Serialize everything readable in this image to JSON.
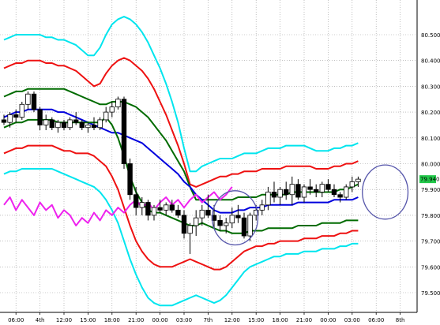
{
  "chart_data": {
    "type": "line",
    "title": "",
    "xlabel": "",
    "ylabel": "",
    "ylim": [
      79.4,
      80.6
    ],
    "grid": true,
    "grid_style": "dotted",
    "background": "#ffffff",
    "y_ticks": [
      "80.500",
      "80.400",
      "80.300",
      "80.200",
      "80.100",
      "80.000",
      "79.900",
      "79.800",
      "79.700",
      "79.600",
      "79.500"
    ],
    "x_ticks": [
      {
        "i": 2,
        "label": "06:00"
      },
      {
        "i": 6,
        "label": "4th"
      },
      {
        "i": 10,
        "label": "12:00"
      },
      {
        "i": 14,
        "label": "15:00"
      },
      {
        "i": 18,
        "label": "18:00"
      },
      {
        "i": 22,
        "label": "21:00"
      },
      {
        "i": 26,
        "label": "00:00"
      },
      {
        "i": 30,
        "label": "03:00"
      },
      {
        "i": 34,
        "label": "7th"
      },
      {
        "i": 38,
        "label": "12:00"
      },
      {
        "i": 42,
        "label": "15:00"
      },
      {
        "i": 46,
        "label": "18:00"
      },
      {
        "i": 50,
        "label": "21:00"
      },
      {
        "i": 54,
        "label": "00:00"
      },
      {
        "i": 58,
        "label": "03:00"
      },
      {
        "i": 62,
        "label": "06:00"
      },
      {
        "i": 66,
        "label": "8th"
      }
    ],
    "current_price": {
      "value": "79.940",
      "color": "#22c84a"
    },
    "candles": {
      "x_start": 0,
      "up_color": "#ffffff",
      "down_color": "#000000",
      "ohlc": [
        [
          80.17,
          80.19,
          80.15,
          80.16
        ],
        [
          80.16,
          80.2,
          80.14,
          80.19
        ],
        [
          80.19,
          80.21,
          80.16,
          80.18
        ],
        [
          80.18,
          80.24,
          80.17,
          80.23
        ],
        [
          80.23,
          80.28,
          80.21,
          80.27
        ],
        [
          80.27,
          80.28,
          80.2,
          80.21
        ],
        [
          80.21,
          80.22,
          80.13,
          80.15
        ],
        [
          80.15,
          80.19,
          80.13,
          80.17
        ],
        [
          80.17,
          80.18,
          80.13,
          80.14
        ],
        [
          80.14,
          80.17,
          80.12,
          80.16
        ],
        [
          80.16,
          80.17,
          80.13,
          80.14
        ],
        [
          80.14,
          80.18,
          80.13,
          80.17
        ],
        [
          80.17,
          80.2,
          80.15,
          80.16
        ],
        [
          80.16,
          80.17,
          80.13,
          80.14
        ],
        [
          80.14,
          80.16,
          80.12,
          80.15
        ],
        [
          80.15,
          80.18,
          80.13,
          80.14
        ],
        [
          80.14,
          80.18,
          80.13,
          80.17
        ],
        [
          80.17,
          80.22,
          80.16,
          80.2
        ],
        [
          80.2,
          80.24,
          80.18,
          80.22
        ],
        [
          80.22,
          80.26,
          80.21,
          80.25
        ],
        [
          80.25,
          80.26,
          79.98,
          80.0
        ],
        [
          80.0,
          80.02,
          79.86,
          79.88
        ],
        [
          79.88,
          79.91,
          79.8,
          79.83
        ],
        [
          79.83,
          79.87,
          79.8,
          79.85
        ],
        [
          79.85,
          79.86,
          79.78,
          79.8
        ],
        [
          79.8,
          79.84,
          79.78,
          79.83
        ],
        [
          79.83,
          79.86,
          79.81,
          79.82
        ],
        [
          79.82,
          79.85,
          79.8,
          79.84
        ],
        [
          79.84,
          79.86,
          79.81,
          79.82
        ],
        [
          79.82,
          79.84,
          79.79,
          79.8
        ],
        [
          79.8,
          79.82,
          79.71,
          79.73
        ],
        [
          79.73,
          79.77,
          79.65,
          79.76
        ],
        [
          79.76,
          79.82,
          79.72,
          79.79
        ],
        [
          79.79,
          79.84,
          79.76,
          79.82
        ],
        [
          79.82,
          79.88,
          79.79,
          79.8
        ],
        [
          79.8,
          79.84,
          79.75,
          79.78
        ],
        [
          79.78,
          79.8,
          79.74,
          79.76
        ],
        [
          79.76,
          79.79,
          79.73,
          79.77
        ],
        [
          79.77,
          79.83,
          79.75,
          79.8
        ],
        [
          79.8,
          79.84,
          79.77,
          79.79
        ],
        [
          79.79,
          79.81,
          79.71,
          79.72
        ],
        [
          79.72,
          79.81,
          79.7,
          79.8
        ],
        [
          79.8,
          79.84,
          79.78,
          79.82
        ],
        [
          79.82,
          79.86,
          79.8,
          79.84
        ],
        [
          79.84,
          79.91,
          79.82,
          79.89
        ],
        [
          79.89,
          79.93,
          79.85,
          79.87
        ],
        [
          79.87,
          79.91,
          79.84,
          79.9
        ],
        [
          79.9,
          79.93,
          79.86,
          79.88
        ],
        [
          79.88,
          79.95,
          79.84,
          79.92
        ],
        [
          79.92,
          79.94,
          79.86,
          79.87
        ],
        [
          79.87,
          79.92,
          79.85,
          79.91
        ],
        [
          79.91,
          79.94,
          79.88,
          79.9
        ],
        [
          79.9,
          79.92,
          79.87,
          79.89
        ],
        [
          79.89,
          79.93,
          79.87,
          79.92
        ],
        [
          79.92,
          79.94,
          79.89,
          79.9
        ],
        [
          79.9,
          79.92,
          79.87,
          79.88
        ],
        [
          79.88,
          79.89,
          79.85,
          79.87
        ],
        [
          79.87,
          79.92,
          79.86,
          79.91
        ],
        [
          79.91,
          79.95,
          79.89,
          79.93
        ],
        [
          79.93,
          79.95,
          79.91,
          79.94
        ]
      ]
    },
    "series": [
      {
        "color": "#00e5ee",
        "x_start": 0,
        "values": [
          80.48,
          80.49,
          80.5,
          80.5,
          80.5,
          80.5,
          80.5,
          80.49,
          80.49,
          80.48,
          80.48,
          80.47,
          80.46,
          80.44,
          80.42,
          80.42,
          80.45,
          80.5,
          80.54,
          80.56,
          80.57,
          80.56,
          80.54,
          80.51,
          80.47,
          80.42,
          80.37,
          80.31,
          80.24,
          80.16,
          80.06,
          79.97,
          79.97,
          79.99,
          80.0,
          80.01,
          80.02,
          80.02,
          80.02,
          80.03,
          80.04,
          80.04,
          80.04,
          80.05,
          80.06,
          80.06,
          80.06,
          80.07,
          80.07,
          80.07,
          80.07,
          80.06,
          80.05,
          80.05,
          80.05,
          80.06,
          80.06,
          80.07,
          80.07,
          80.08
        ]
      },
      {
        "color": "#ee1111",
        "x_start": 0,
        "values": [
          80.37,
          80.38,
          80.39,
          80.39,
          80.4,
          80.4,
          80.4,
          80.39,
          80.39,
          80.38,
          80.38,
          80.37,
          80.36,
          80.34,
          80.32,
          80.3,
          80.31,
          80.35,
          80.38,
          80.4,
          80.41,
          80.4,
          80.38,
          80.36,
          80.33,
          80.29,
          80.24,
          80.19,
          80.13,
          80.07,
          80.0,
          79.92,
          79.91,
          79.92,
          79.93,
          79.94,
          79.95,
          79.95,
          79.96,
          79.96,
          79.97,
          79.97,
          79.97,
          79.98,
          79.98,
          79.98,
          79.98,
          79.99,
          79.99,
          79.99,
          79.99,
          79.99,
          79.98,
          79.98,
          79.98,
          79.99,
          79.99,
          80.0,
          80.0,
          80.01
        ]
      },
      {
        "color": "#006b00",
        "x_start": 0,
        "values": [
          80.26,
          80.27,
          80.28,
          80.28,
          80.29,
          80.29,
          80.29,
          80.29,
          80.29,
          80.29,
          80.29,
          80.28,
          80.27,
          80.26,
          80.25,
          80.24,
          80.23,
          80.23,
          80.24,
          80.24,
          80.24,
          80.23,
          80.22,
          80.2,
          80.18,
          80.15,
          80.12,
          80.09,
          80.05,
          80.01,
          79.97,
          79.91,
          79.86,
          79.86,
          79.86,
          79.86,
          79.86,
          79.86,
          79.86,
          79.87,
          79.87,
          79.87,
          79.87,
          79.88,
          79.88,
          79.88,
          79.88,
          79.88,
          79.89,
          79.89,
          79.89,
          79.89,
          79.89,
          79.89,
          79.89,
          79.89,
          79.9,
          79.9,
          79.91,
          79.92
        ]
      },
      {
        "color": "#0000dd",
        "x_start": 0,
        "values": [
          80.18,
          80.19,
          80.2,
          80.2,
          80.21,
          80.21,
          80.21,
          80.21,
          80.21,
          80.2,
          80.2,
          80.19,
          80.18,
          80.17,
          80.16,
          80.15,
          80.14,
          80.13,
          80.12,
          80.12,
          80.11,
          80.1,
          80.09,
          80.08,
          80.06,
          80.04,
          80.02,
          80.0,
          79.98,
          79.96,
          79.93,
          79.91,
          79.88,
          79.86,
          79.84,
          79.82,
          79.81,
          79.81,
          79.81,
          79.82,
          79.82,
          79.83,
          79.83,
          79.83,
          79.84,
          79.84,
          79.84,
          79.84,
          79.84,
          79.85,
          79.85,
          79.85,
          79.85,
          79.85,
          79.85,
          79.86,
          79.86,
          79.86,
          79.86,
          79.87
        ]
      },
      {
        "color": "#006b00",
        "x_start": 0,
        "values": [
          80.14,
          80.15,
          80.16,
          80.16,
          80.17,
          80.17,
          80.17,
          80.17,
          80.17,
          80.16,
          80.16,
          80.16,
          80.16,
          80.16,
          80.16,
          80.16,
          80.16,
          80.18,
          80.15,
          80.1,
          80.03,
          79.95,
          79.89,
          79.85,
          79.82,
          79.81,
          79.81,
          79.8,
          79.79,
          79.78,
          79.77,
          79.76,
          79.76,
          79.77,
          79.76,
          79.75,
          79.74,
          79.74,
          79.73,
          79.73,
          79.73,
          79.74,
          79.74,
          79.74,
          79.75,
          79.75,
          79.75,
          79.75,
          79.75,
          79.76,
          79.76,
          79.76,
          79.76,
          79.77,
          79.77,
          79.77,
          79.77,
          79.78,
          79.78,
          79.78
        ]
      },
      {
        "color": "#ee1111",
        "x_start": 0,
        "values": [
          80.04,
          80.05,
          80.06,
          80.06,
          80.07,
          80.07,
          80.07,
          80.07,
          80.07,
          80.06,
          80.05,
          80.05,
          80.04,
          80.04,
          80.04,
          80.03,
          80.01,
          79.99,
          79.95,
          79.9,
          79.83,
          79.76,
          79.7,
          79.66,
          79.63,
          79.61,
          79.6,
          79.6,
          79.6,
          79.61,
          79.62,
          79.63,
          79.62,
          79.61,
          79.6,
          79.59,
          79.59,
          79.6,
          79.62,
          79.64,
          79.66,
          79.67,
          79.68,
          79.68,
          79.69,
          79.69,
          79.7,
          79.7,
          79.7,
          79.7,
          79.71,
          79.71,
          79.71,
          79.72,
          79.72,
          79.72,
          79.73,
          79.73,
          79.74,
          79.74
        ]
      },
      {
        "color": "#00e5ee",
        "x_start": 0,
        "values": [
          79.96,
          79.97,
          79.97,
          79.98,
          79.98,
          79.98,
          79.98,
          79.98,
          79.98,
          79.97,
          79.96,
          79.95,
          79.94,
          79.93,
          79.92,
          79.91,
          79.89,
          79.86,
          79.82,
          79.77,
          79.7,
          79.63,
          79.57,
          79.52,
          79.48,
          79.46,
          79.45,
          79.45,
          79.45,
          79.46,
          79.47,
          79.48,
          79.49,
          79.48,
          79.47,
          79.46,
          79.47,
          79.49,
          79.52,
          79.55,
          79.58,
          79.6,
          79.61,
          79.62,
          79.63,
          79.64,
          79.64,
          79.65,
          79.65,
          79.65,
          79.66,
          79.66,
          79.66,
          79.67,
          79.67,
          79.67,
          79.68,
          79.68,
          79.69,
          79.69
        ]
      },
      {
        "color": "#ee22ee",
        "x_start": 0,
        "values": [
          79.84,
          79.87,
          79.82,
          79.86,
          79.83,
          79.8,
          79.85,
          79.82,
          79.84,
          79.79,
          79.82,
          79.8,
          79.76,
          79.79,
          79.77,
          79.81,
          79.78,
          79.82,
          79.8,
          79.83,
          79.81,
          79.84,
          79.86,
          79.83,
          79.85,
          79.82,
          79.85,
          79.87,
          79.84,
          79.86,
          79.83,
          79.86,
          79.88,
          79.85,
          79.87,
          79.89,
          79.86,
          79.88,
          79.91
        ]
      }
    ],
    "annotations": [
      {
        "type": "ellipse",
        "color": "#5555aa",
        "x_center": 38.5,
        "y_center": 79.79,
        "x_radius": 3.8,
        "y_radius": 0.105
      },
      {
        "type": "ellipse",
        "color": "#5555aa",
        "x_center": 63.5,
        "y_center": 79.89,
        "x_radius": 3.8,
        "y_radius": 0.105
      }
    ]
  }
}
